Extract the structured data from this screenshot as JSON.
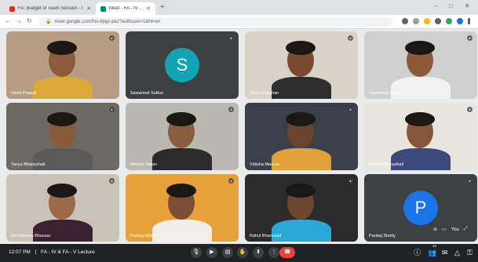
{
  "browser": {
    "tabs": [
      {
        "label": "FA: Budget of Team Session - I",
        "favicon_color": "#d93025"
      },
      {
        "label": "Meet - FA - IV & FA - V Lecture",
        "favicon_color": "#00897b",
        "active": true
      }
    ],
    "new_tab": "+",
    "url": "meet.google.com/fnx-dpgz-pez?authuser=1&hl=en"
  },
  "participants": [
    {
      "name": "Vivek Prasad",
      "tile_bg": "#b59c82",
      "skin": "#8d5a3b",
      "shirt": "#d9a93a",
      "kind": "video"
    },
    {
      "name": "Sawarmal Suthar",
      "tile_bg": "#3c4043",
      "avatar_letter": "S",
      "avatar_color": "#12a4b4",
      "kind": "avatar"
    },
    {
      "name": "Vivek Chauhan",
      "tile_bg": "#d8d2c9",
      "skin": "#7a4a2e",
      "shirt": "#2d2d2d",
      "kind": "video"
    },
    {
      "name": "Sawarmal Suthar",
      "tile_bg": "#cfcfcf",
      "skin": "#8c5a3a",
      "shirt": "#f0f0f0",
      "kind": "video"
    },
    {
      "name": "Tanya Bhanushali",
      "tile_bg": "#6d6a63",
      "skin": "#8a5a3a",
      "shirt": "#5a5a5a",
      "kind": "video"
    },
    {
      "name": "Mansvi Yadav",
      "tile_bg": "#b9b8b3",
      "skin": "#8a5d40",
      "shirt": "#2a2a2a",
      "kind": "video"
    },
    {
      "name": "Vidisha Maurya",
      "tile_bg": "#3a3f4a",
      "skin": "#6b4430",
      "shirt": "#e0a13a",
      "kind": "video"
    },
    {
      "name": "Aniket Bhanushali",
      "tile_bg": "#e8e5df",
      "skin": "#86573c",
      "shirt": "#3b4a7a",
      "kind": "video"
    },
    {
      "name": "Mehakdeep Bhavsar",
      "tile_bg": "#c9c2b7",
      "skin": "#9b6a4a",
      "shirt": "#3a2230",
      "kind": "video"
    },
    {
      "name": "Pankaj Mishra",
      "tile_bg": "#e6a13a",
      "skin": "#7d4e33",
      "shirt": "#f2efe9",
      "kind": "video"
    },
    {
      "name": "Rahul Bhanusali",
      "tile_bg": "#2b2b2b",
      "skin": "#6e452f",
      "shirt": "#2aa8d8",
      "kind": "video"
    },
    {
      "name": "Pankaj Shetty",
      "tile_bg": "#3c4043",
      "avatar_letter": "P",
      "avatar_color": "#1a73e8",
      "kind": "self"
    }
  ],
  "self_tile": {
    "you_label": "You"
  },
  "bottom": {
    "time": "12:07 PM",
    "meeting": "FA - IV & FA - V Lecture",
    "separator": "|",
    "participant_count": "12"
  },
  "icons": {
    "mic": "mic-icon",
    "camera": "camera-icon",
    "captions": "captions-icon",
    "hand": "raise-hand-icon",
    "present": "present-icon",
    "more": "more-options-icon",
    "end": "end-call-icon",
    "info": "info-icon",
    "people": "people-icon",
    "chat": "chat-icon",
    "activities": "activities-icon",
    "lock": "lock-icon"
  },
  "colors": {
    "meet_bg": "#202124",
    "end_call": "#ea4335",
    "avatar_teal": "#12a4b4"
  }
}
